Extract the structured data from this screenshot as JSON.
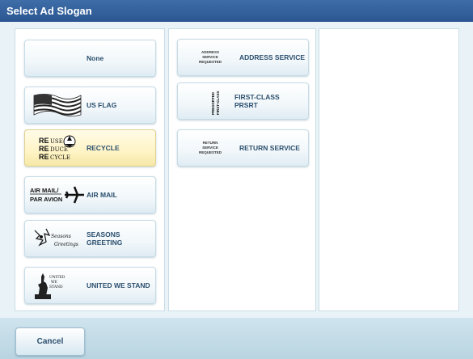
{
  "window": {
    "title": "Select Ad Slogan"
  },
  "slogans_col1": [
    {
      "label": "None",
      "selected": false
    },
    {
      "label": "US FLAG",
      "selected": false
    },
    {
      "label": "RECYCLE",
      "selected": true
    },
    {
      "label": "AIR MAIL",
      "selected": false
    },
    {
      "label": "SEASONS\nGREETING",
      "selected": false
    },
    {
      "label": "UNITED WE STAND",
      "selected": false
    }
  ],
  "slogans_col2": [
    {
      "label": "ADDRESS SERVICE",
      "thumb_text": [
        "ADDRESS",
        "SERVICE",
        "REQUESTED"
      ]
    },
    {
      "label": "FIRST-CLASS\nPRSRT",
      "thumb_text": [
        "PRESORTED",
        "FIRST-CLASS"
      ]
    },
    {
      "label": "RETURN SERVICE",
      "thumb_text": [
        "RETURN",
        "SERVICE",
        "REQUESTED"
      ]
    }
  ],
  "thumbs": {
    "recycle": [
      "RE",
      "RE",
      "RE",
      "USE",
      "DUCE",
      "CYCLE"
    ],
    "airmail": [
      "AIR MAIL/",
      "PAR AVION"
    ],
    "seasons": [
      "Seasons",
      "Greetings"
    ],
    "unitedwestand": [
      "UNITED",
      "WE",
      "STAND"
    ]
  },
  "footer": {
    "cancel_label": "Cancel"
  },
  "colors": {
    "title_bg": "#3e6da7",
    "selected_bg": "#fff4c6",
    "label": "#2b4f6e"
  }
}
